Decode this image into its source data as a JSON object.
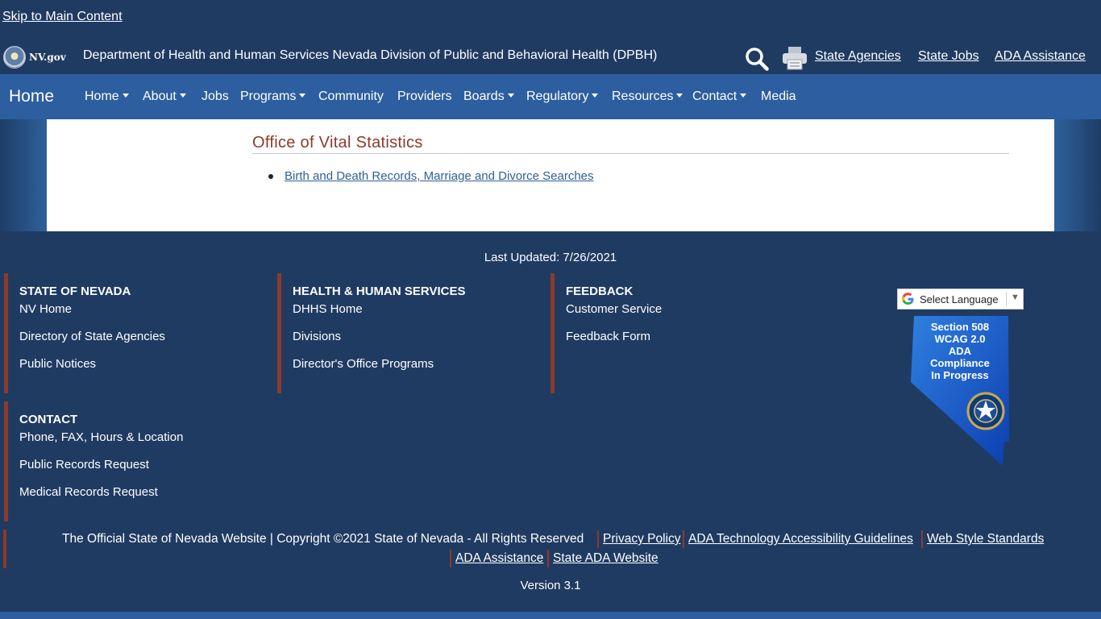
{
  "skip_link": "Skip to Main Content",
  "header": {
    "logo_text": "NV.gov",
    "title": "Department of Health and Human Services Nevada Division of Public and Behavioral Health (DPBH)",
    "links": [
      "State Agencies",
      "State Jobs",
      "ADA Assistance"
    ],
    "icons": [
      "search-icon",
      "printer-icon"
    ]
  },
  "nav": {
    "brand": "Home",
    "items": [
      {
        "label": "Home",
        "dropdown": true
      },
      {
        "label": "About",
        "dropdown": true
      },
      {
        "label": "Jobs",
        "dropdown": false
      },
      {
        "label": "Programs",
        "dropdown": true
      },
      {
        "label": "Community",
        "dropdown": false
      },
      {
        "label": "Providers",
        "dropdown": false
      },
      {
        "label": "Boards",
        "dropdown": true
      },
      {
        "label": "Regulatory",
        "dropdown": true
      },
      {
        "label": "Resources",
        "dropdown": true
      },
      {
        "label": "Contact",
        "dropdown": true
      },
      {
        "label": "Media",
        "dropdown": false
      }
    ]
  },
  "main": {
    "section_title": "Office of Vital Statistics",
    "links": [
      "Birth and Death Records, Marriage and Divorce Searches"
    ]
  },
  "footer": {
    "last_updated": "Last Updated: 7/26/2021",
    "columns": [
      {
        "heading": "STATE OF NEVADA",
        "links": [
          "NV Home",
          "Directory of State Agencies",
          "Public Notices"
        ]
      },
      {
        "heading": "HEALTH & HUMAN SERVICES",
        "links": [
          "DHHS Home",
          "Divisions",
          "Director's Office Programs"
        ]
      },
      {
        "heading": "FEEDBACK",
        "links": [
          "Customer Service",
          "Feedback Form"
        ]
      },
      {
        "heading": "CONTACT",
        "links": [
          "Phone, FAX, Hours & Location",
          "Public Records Request",
          "Medical Records Request"
        ]
      }
    ],
    "translate_label": "Select Language",
    "badge_text": [
      "Section 508",
      "WCAG 2.0",
      "ADA",
      "Compliance",
      "In Progress"
    ],
    "copyright": "The Official State of Nevada Website | Copyright ©2021 State of Nevada - All Rights Reserved",
    "legal_links": [
      "Privacy Policy",
      "ADA Technology Accessibility Guidelines",
      "Web Style Standards",
      "ADA Assistance",
      "State ADA Website"
    ],
    "version": "Version 3.1"
  },
  "colors": {
    "page_bg": "#1f3b62",
    "nav_bg": "#2c5ea0",
    "accent_rule": "#8c3a2b",
    "section_title": "#8c3a2b",
    "link": "#2e5f95"
  }
}
